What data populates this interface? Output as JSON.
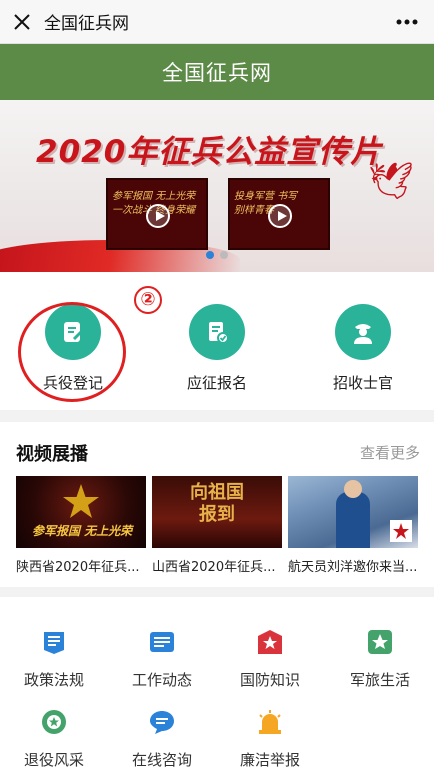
{
  "topbar": {
    "title": "全国征兵网"
  },
  "header": {
    "title": "全国征兵网"
  },
  "banner": {
    "headline": "2020年征兵公益宣传片",
    "videos": [
      {
        "text": "参军报国 无上光荣\n一次战斗 终身荣耀"
      },
      {
        "text": "投身军营 书写\n别样青春"
      }
    ],
    "dots": 2,
    "active_dot": 0
  },
  "services": [
    {
      "label": "兵役登记",
      "icon": "edit-icon"
    },
    {
      "label": "应征报名",
      "icon": "document-check-icon"
    },
    {
      "label": "招收士官",
      "icon": "officer-icon"
    }
  ],
  "annotation": {
    "number": "②"
  },
  "videos": {
    "title": "视频展播",
    "more": "查看更多",
    "items": [
      {
        "caption": "陕西省2020年征兵...",
        "thumb_text": "参军报国 无上光荣"
      },
      {
        "caption": "山西省2020年征兵...",
        "thumb_text": "向祖国报到"
      },
      {
        "caption": "航天员刘洋邀你来当...",
        "thumb_text": ""
      }
    ]
  },
  "grid": [
    {
      "label": "政策法规",
      "icon": "book-icon"
    },
    {
      "label": "工作动态",
      "icon": "list-icon"
    },
    {
      "label": "国防知识",
      "icon": "star-badge-icon"
    },
    {
      "label": "军旅生活",
      "icon": "star-frame-icon"
    },
    {
      "label": "退役风采",
      "icon": "wreath-icon"
    },
    {
      "label": "在线咨询",
      "icon": "chat-icon"
    },
    {
      "label": "廉洁举报",
      "icon": "alarm-icon"
    }
  ],
  "colors": {
    "header": "#5c8a47",
    "teal": "#2bb39a",
    "blue": "#2b82d9",
    "red": "#e02020"
  }
}
